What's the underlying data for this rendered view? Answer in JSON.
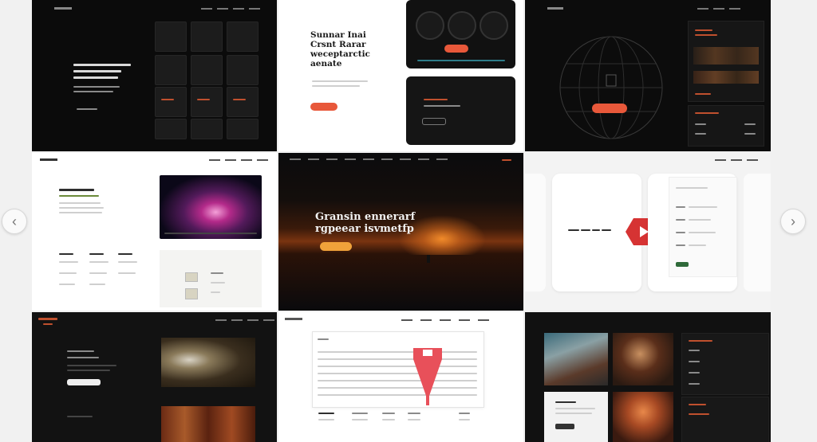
{
  "gallery": {
    "tiles": [
      {
        "id": "dark-grid",
        "theme": "dark"
      },
      {
        "id": "white-split",
        "theme": "light",
        "headline": [
          "Sunnar Inai",
          "Crsnt Rarar",
          "weceptarctic",
          "aenate"
        ]
      },
      {
        "id": "dark-globe",
        "theme": "dark"
      },
      {
        "id": "light-media",
        "theme": "light"
      },
      {
        "id": "sunset-hero",
        "theme": "dark",
        "headline": [
          "Gransin ennerarf",
          "rgpeear isvmetfp"
        ]
      },
      {
        "id": "play-feature",
        "theme": "light"
      },
      {
        "id": "dark-portfolio",
        "theme": "dark"
      },
      {
        "id": "dashboard-table",
        "theme": "light"
      },
      {
        "id": "photo-grid",
        "theme": "dark"
      }
    ]
  },
  "navigation": {
    "prev_icon": "‹",
    "next_icon": "›"
  },
  "colors": {
    "accent": "#e8583a",
    "sunset_orange": "#e0781c",
    "cta_amber": "#f0a23a",
    "play_red": "#d63333",
    "page_bg": "#f1f1f1",
    "dark_bg": "#0e0e0e"
  }
}
